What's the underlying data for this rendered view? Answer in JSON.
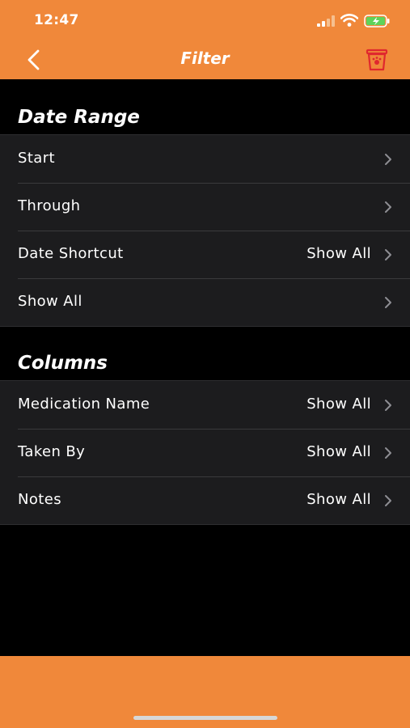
{
  "status": {
    "time": "12:47"
  },
  "nav": {
    "title": "Filter",
    "back_icon": "chevron-left-icon",
    "trash_icon": "trash-icon"
  },
  "sections": [
    {
      "header": "Date Range",
      "rows": [
        {
          "label": "Start",
          "value": ""
        },
        {
          "label": "Through",
          "value": ""
        },
        {
          "label": "Date Shortcut",
          "value": "Show All"
        },
        {
          "label": "Show All",
          "value": ""
        }
      ]
    },
    {
      "header": "Columns",
      "rows": [
        {
          "label": "Medication Name",
          "value": "Show All"
        },
        {
          "label": "Taken By",
          "value": "Show All"
        },
        {
          "label": "Notes",
          "value": "Show All"
        }
      ]
    }
  ],
  "colors": {
    "accent": "#F0883A",
    "trash": "#E0282E",
    "background": "#000000",
    "cell": "#1C1C1E"
  }
}
